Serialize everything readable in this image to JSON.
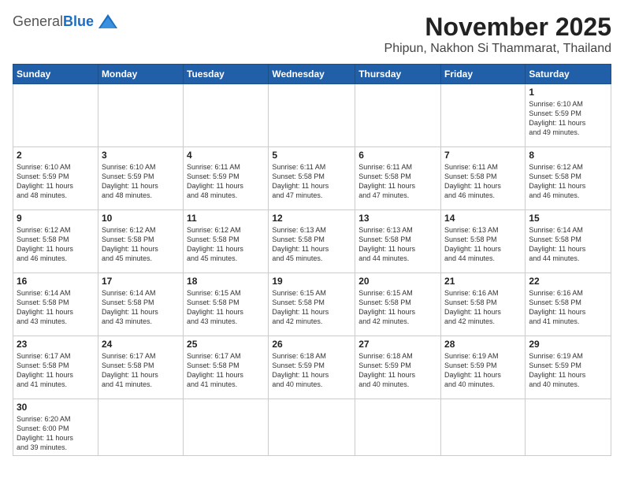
{
  "header": {
    "logo_general": "General",
    "logo_blue": "Blue",
    "month_title": "November 2025",
    "subtitle": "Phipun, Nakhon Si Thammarat, Thailand"
  },
  "weekdays": [
    "Sunday",
    "Monday",
    "Tuesday",
    "Wednesday",
    "Thursday",
    "Friday",
    "Saturday"
  ],
  "weeks": [
    [
      {
        "day": "",
        "info": ""
      },
      {
        "day": "",
        "info": ""
      },
      {
        "day": "",
        "info": ""
      },
      {
        "day": "",
        "info": ""
      },
      {
        "day": "",
        "info": ""
      },
      {
        "day": "",
        "info": ""
      },
      {
        "day": "1",
        "info": "Sunrise: 6:10 AM\nSunset: 5:59 PM\nDaylight: 11 hours\nand 49 minutes."
      }
    ],
    [
      {
        "day": "2",
        "info": "Sunrise: 6:10 AM\nSunset: 5:59 PM\nDaylight: 11 hours\nand 48 minutes."
      },
      {
        "day": "3",
        "info": "Sunrise: 6:10 AM\nSunset: 5:59 PM\nDaylight: 11 hours\nand 48 minutes."
      },
      {
        "day": "4",
        "info": "Sunrise: 6:11 AM\nSunset: 5:59 PM\nDaylight: 11 hours\nand 48 minutes."
      },
      {
        "day": "5",
        "info": "Sunrise: 6:11 AM\nSunset: 5:58 PM\nDaylight: 11 hours\nand 47 minutes."
      },
      {
        "day": "6",
        "info": "Sunrise: 6:11 AM\nSunset: 5:58 PM\nDaylight: 11 hours\nand 47 minutes."
      },
      {
        "day": "7",
        "info": "Sunrise: 6:11 AM\nSunset: 5:58 PM\nDaylight: 11 hours\nand 46 minutes."
      },
      {
        "day": "8",
        "info": "Sunrise: 6:12 AM\nSunset: 5:58 PM\nDaylight: 11 hours\nand 46 minutes."
      }
    ],
    [
      {
        "day": "9",
        "info": "Sunrise: 6:12 AM\nSunset: 5:58 PM\nDaylight: 11 hours\nand 46 minutes."
      },
      {
        "day": "10",
        "info": "Sunrise: 6:12 AM\nSunset: 5:58 PM\nDaylight: 11 hours\nand 45 minutes."
      },
      {
        "day": "11",
        "info": "Sunrise: 6:12 AM\nSunset: 5:58 PM\nDaylight: 11 hours\nand 45 minutes."
      },
      {
        "day": "12",
        "info": "Sunrise: 6:13 AM\nSunset: 5:58 PM\nDaylight: 11 hours\nand 45 minutes."
      },
      {
        "day": "13",
        "info": "Sunrise: 6:13 AM\nSunset: 5:58 PM\nDaylight: 11 hours\nand 44 minutes."
      },
      {
        "day": "14",
        "info": "Sunrise: 6:13 AM\nSunset: 5:58 PM\nDaylight: 11 hours\nand 44 minutes."
      },
      {
        "day": "15",
        "info": "Sunrise: 6:14 AM\nSunset: 5:58 PM\nDaylight: 11 hours\nand 44 minutes."
      }
    ],
    [
      {
        "day": "16",
        "info": "Sunrise: 6:14 AM\nSunset: 5:58 PM\nDaylight: 11 hours\nand 43 minutes."
      },
      {
        "day": "17",
        "info": "Sunrise: 6:14 AM\nSunset: 5:58 PM\nDaylight: 11 hours\nand 43 minutes."
      },
      {
        "day": "18",
        "info": "Sunrise: 6:15 AM\nSunset: 5:58 PM\nDaylight: 11 hours\nand 43 minutes."
      },
      {
        "day": "19",
        "info": "Sunrise: 6:15 AM\nSunset: 5:58 PM\nDaylight: 11 hours\nand 42 minutes."
      },
      {
        "day": "20",
        "info": "Sunrise: 6:15 AM\nSunset: 5:58 PM\nDaylight: 11 hours\nand 42 minutes."
      },
      {
        "day": "21",
        "info": "Sunrise: 6:16 AM\nSunset: 5:58 PM\nDaylight: 11 hours\nand 42 minutes."
      },
      {
        "day": "22",
        "info": "Sunrise: 6:16 AM\nSunset: 5:58 PM\nDaylight: 11 hours\nand 41 minutes."
      }
    ],
    [
      {
        "day": "23",
        "info": "Sunrise: 6:17 AM\nSunset: 5:58 PM\nDaylight: 11 hours\nand 41 minutes."
      },
      {
        "day": "24",
        "info": "Sunrise: 6:17 AM\nSunset: 5:58 PM\nDaylight: 11 hours\nand 41 minutes."
      },
      {
        "day": "25",
        "info": "Sunrise: 6:17 AM\nSunset: 5:58 PM\nDaylight: 11 hours\nand 41 minutes."
      },
      {
        "day": "26",
        "info": "Sunrise: 6:18 AM\nSunset: 5:59 PM\nDaylight: 11 hours\nand 40 minutes."
      },
      {
        "day": "27",
        "info": "Sunrise: 6:18 AM\nSunset: 5:59 PM\nDaylight: 11 hours\nand 40 minutes."
      },
      {
        "day": "28",
        "info": "Sunrise: 6:19 AM\nSunset: 5:59 PM\nDaylight: 11 hours\nand 40 minutes."
      },
      {
        "day": "29",
        "info": "Sunrise: 6:19 AM\nSunset: 5:59 PM\nDaylight: 11 hours\nand 40 minutes."
      }
    ],
    [
      {
        "day": "30",
        "info": "Sunrise: 6:20 AM\nSunset: 6:00 PM\nDaylight: 11 hours\nand 39 minutes."
      },
      {
        "day": "",
        "info": ""
      },
      {
        "day": "",
        "info": ""
      },
      {
        "day": "",
        "info": ""
      },
      {
        "day": "",
        "info": ""
      },
      {
        "day": "",
        "info": ""
      },
      {
        "day": "",
        "info": ""
      }
    ]
  ]
}
